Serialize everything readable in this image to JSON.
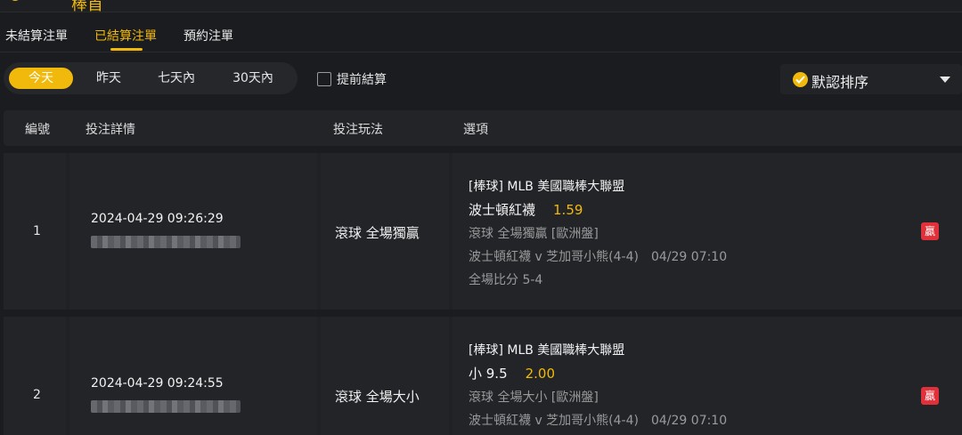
{
  "header": {
    "title": "棒首"
  },
  "tabs": [
    {
      "label": "未結算注單",
      "active": false
    },
    {
      "label": "已結算注單",
      "active": true
    },
    {
      "label": "預約注單",
      "active": false
    }
  ],
  "filters": {
    "periods": [
      {
        "label": "今天",
        "active": true
      },
      {
        "label": "昨天",
        "active": false
      },
      {
        "label": "七天內",
        "active": false
      },
      {
        "label": "30天內",
        "active": false
      }
    ],
    "early_settlement_label": "提前結算",
    "early_settlement_checked": false,
    "sort": {
      "label": "默認排序",
      "icon": "check-circle-icon"
    }
  },
  "table": {
    "headers": [
      "編號",
      "投注詳情",
      "投注玩法",
      "選項"
    ],
    "rows": [
      {
        "no": "1",
        "time": "2024-04-29 09:26:29",
        "play": "滾球  全場獨贏",
        "league": "[棒球] MLB 美國職棒大聯盟",
        "pick": "波士頓紅襪",
        "odds": "1.59",
        "market": "滾球 全場獨贏 [歐洲盤]",
        "match": "波士頓紅襪 v 芝加哥小熊(4-4)",
        "match_time": "04/29 07:10",
        "score": "全場比分 5-4",
        "result": "贏"
      },
      {
        "no": "2",
        "time": "2024-04-29 09:24:55",
        "play": "滾球  全場大小",
        "league": "[棒球] MLB 美國職棒大聯盟",
        "pick": "小 9.5",
        "odds": "2.00",
        "market": "滾球 全場大小 [歐洲盤]",
        "match": "波士頓紅襪 v 芝加哥小熊(4-4)",
        "match_time": "04/29 07:10",
        "result": "贏"
      }
    ]
  },
  "colors": {
    "accent": "#f0b90b",
    "background": "#1b1c1f",
    "panel": "#232428",
    "win_badge": "#e0313a",
    "muted_text": "#9a9a9a"
  }
}
